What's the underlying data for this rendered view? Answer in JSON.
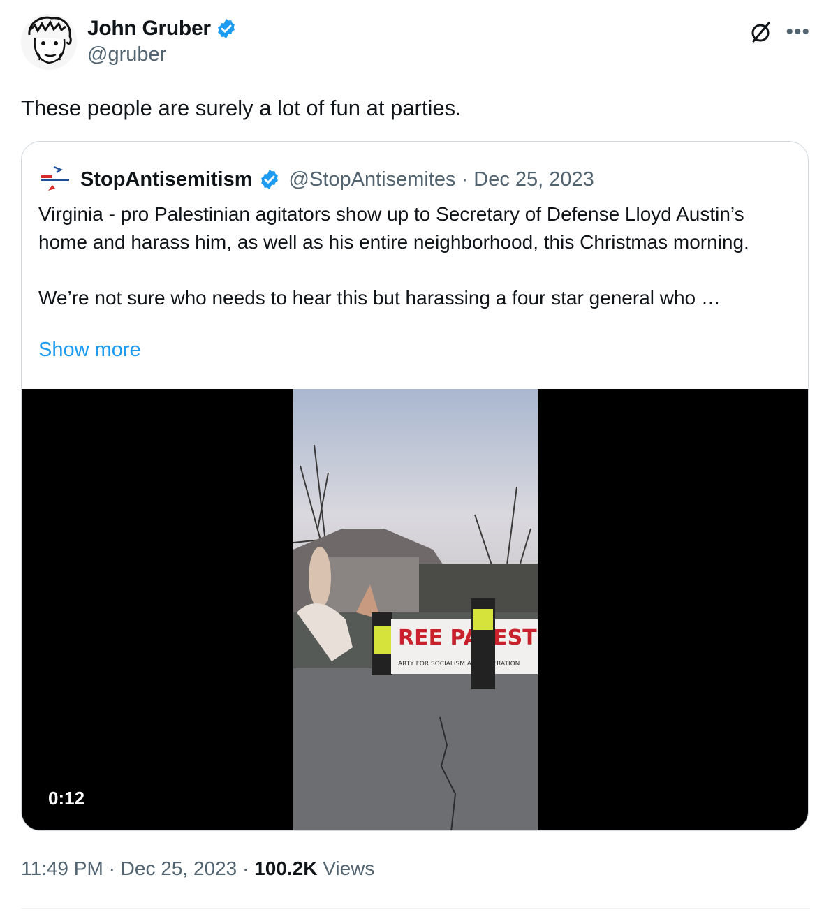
{
  "tweet": {
    "author": {
      "name": "John Gruber",
      "handle": "@gruber"
    },
    "text": "These people are surely a lot of fun at parties.",
    "timestamp": "11:49 PM",
    "date": "Dec 25, 2023",
    "views_count": "100.2K",
    "views_label": "Views",
    "separator": "·"
  },
  "quote": {
    "author": {
      "name": "StopAntisemitism",
      "handle_date": "@StopAntisemites · Dec 25, 2023"
    },
    "body": "Virginia - pro Palestinian agitators show up to Secretary of Defense Lloyd Austin’s home and harass him, as well as his entire neighborhood, this Christmas morning.\n\nWe’re not sure who needs to hear this but harassing a four star general who …",
    "show_more": "Show more",
    "video": {
      "duration": "0:12",
      "banner_main": "REE PALESTINE!",
      "banner_sub": "ARTY FOR SOCIALISM AND LIBERATION"
    }
  },
  "colors": {
    "accent": "#1d9bf0",
    "muted": "#536471",
    "border": "#cfd9de"
  },
  "icons": [
    "verified-badge-icon",
    "grok-icon",
    "more-options-icon"
  ]
}
